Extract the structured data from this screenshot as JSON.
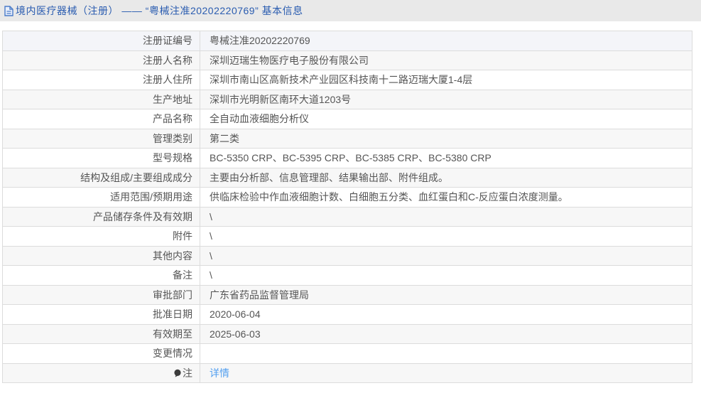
{
  "page": {
    "title": "境内医疗器械（注册） —— “粤械注准20202220769” 基本信息"
  },
  "colors": {
    "header_bg": "#e9e9e9",
    "header_text": "#2a5cb0",
    "link_blue": "#54a0f0",
    "row_alt_bg": "#f7f7f7",
    "row_hover_bg": "#f4f5f9",
    "border": "#dcdcdc",
    "text": "#555555"
  },
  "table": {
    "rows": [
      {
        "label": "注册证编号",
        "value": "粤械注准20202220769"
      },
      {
        "label": "注册人名称",
        "value": "深圳迈瑞生物医疗电子股份有限公司"
      },
      {
        "label": "注册人住所",
        "value": "深圳市南山区高新技术产业园区科技南十二路迈瑞大厦1-4层"
      },
      {
        "label": "生产地址",
        "value": "深圳市光明新区南环大道1203号"
      },
      {
        "label": "产品名称",
        "value": "全自动血液细胞分析仪"
      },
      {
        "label": "管理类别",
        "value": "第二类"
      },
      {
        "label": "型号规格",
        "value": "BC-5350 CRP、BC-5395 CRP、BC-5385 CRP、BC-5380 CRP"
      },
      {
        "label": "结构及组成/主要组成成分",
        "value": "主要由分析部、信息管理部、结果输出部、附件组成。"
      },
      {
        "label": "适用范围/预期用途",
        "value": "供临床检验中作血液细胞计数、白细胞五分类、血红蛋白和C-反应蛋白浓度测量。"
      },
      {
        "label": "产品储存条件及有效期",
        "value": "\\"
      },
      {
        "label": "附件",
        "value": "\\"
      },
      {
        "label": "其他内容",
        "value": "\\"
      },
      {
        "label": "备注",
        "value": "\\"
      },
      {
        "label": "审批部门",
        "value": "广东省药品监督管理局"
      },
      {
        "label": "批准日期",
        "value": "2020-06-04"
      },
      {
        "label": "有效期至",
        "value": "2025-06-03"
      },
      {
        "label": "变更情况",
        "value": ""
      },
      {
        "label": "注",
        "value": "详情",
        "value_is_link": true,
        "label_has_note_icon": true
      }
    ]
  }
}
